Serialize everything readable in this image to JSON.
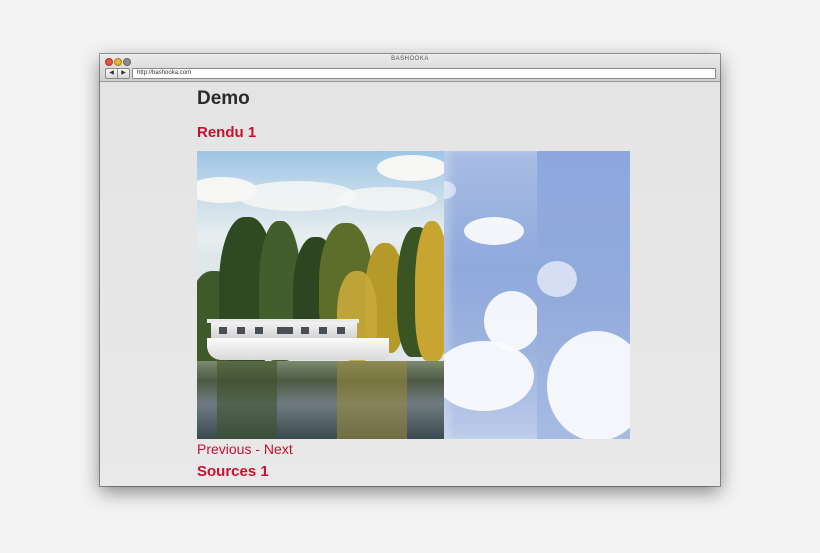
{
  "window": {
    "title": "BASHOOKA",
    "address": "http://bashooka.com",
    "back_label": "◀",
    "forward_label": "▶"
  },
  "page": {
    "title": "Demo",
    "section1_title": "Rendu 1",
    "previous_label": "Previous",
    "separator": " - ",
    "next_label": "Next",
    "section2_title": "Sources 1"
  },
  "colors": {
    "accent": "#c8102e",
    "heading": "#2a2a2a",
    "background": "#e6e6e6"
  }
}
